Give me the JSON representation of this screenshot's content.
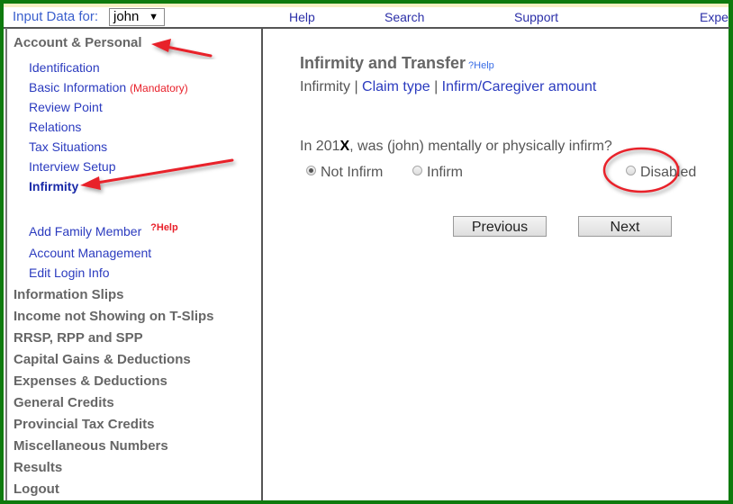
{
  "topbar": {
    "input_label": "Input Data for:",
    "user_select": "john",
    "caret": "▼",
    "nav": [
      {
        "label": "Help"
      },
      {
        "label": "Search"
      },
      {
        "label": "Support"
      },
      {
        "label": "Expe"
      }
    ]
  },
  "sidebar": {
    "account_personal": "Account & Personal",
    "sub_items": [
      {
        "label": "Identification"
      },
      {
        "label": "Basic Information",
        "note": "(Mandatory)"
      },
      {
        "label": "Review Point"
      },
      {
        "label": "Relations"
      },
      {
        "label": "Tax Situations"
      },
      {
        "label": "Interview Setup"
      },
      {
        "label": "Infirmity",
        "active": true
      }
    ],
    "extra_items": [
      {
        "label": "Add Family Member",
        "help": "?Help"
      },
      {
        "label": "Account Management"
      },
      {
        "label": "Edit Login Info"
      }
    ],
    "sections": [
      {
        "label": "Information Slips"
      },
      {
        "label": "Income not Showing on T-Slips"
      },
      {
        "label": "RRSP, RPP and SPP"
      },
      {
        "label": "Capital Gains & Deductions"
      },
      {
        "label": "Expenses & Deductions"
      },
      {
        "label": "General Credits"
      },
      {
        "label": "Provincial Tax Credits"
      },
      {
        "label": "Miscellaneous Numbers"
      },
      {
        "label": "Results"
      },
      {
        "label": "Logout"
      }
    ]
  },
  "main": {
    "title": "Infirmity and Transfer",
    "help": "?Help",
    "breadcrumb": {
      "current": "Infirmity",
      "sep": " | ",
      "links": [
        "Claim type",
        "Infirm/Caregiver amount"
      ]
    },
    "question": {
      "prefix": "In 201",
      "year_bold": "X",
      "suffix": ", was (john) mentally or physically infirm?"
    },
    "options": [
      {
        "label": "Not Infirm",
        "checked": true
      },
      {
        "label": "Infirm",
        "checked": false
      },
      {
        "label": "Disabled",
        "checked": false
      }
    ],
    "buttons": {
      "previous": "Previous",
      "next": "Next"
    }
  },
  "colors": {
    "frame": "#0e7a0d",
    "link": "#2b3bbf",
    "mandatory": "#e8202a",
    "annotation": "#e8202a"
  }
}
